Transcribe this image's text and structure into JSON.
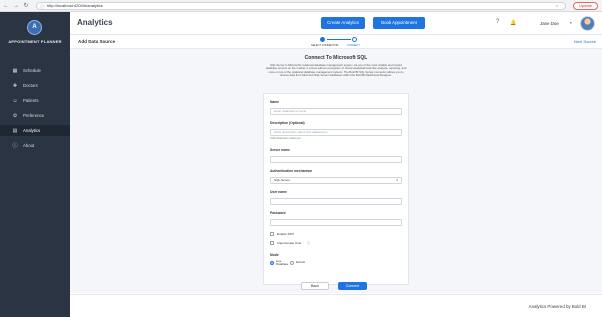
{
  "browser": {
    "back": "←",
    "forward": "→",
    "reload": "↻",
    "url": "http://localhost:4200/#/analytics",
    "update_label": "Update"
  },
  "sidebar": {
    "logo_glyph": "A",
    "brand": "APPOINTMENT PLANNER",
    "items": [
      {
        "label": "Schedule",
        "icon": "calendar-icon",
        "glyph": "▦"
      },
      {
        "label": "Doctors",
        "icon": "doctor-icon",
        "glyph": "✚"
      },
      {
        "label": "Patients",
        "icon": "patients-icon",
        "glyph": "☺"
      },
      {
        "label": "Preference",
        "icon": "gear-icon",
        "glyph": "⚙"
      },
      {
        "label": "Analytics",
        "icon": "analytics-icon",
        "glyph": "▤"
      },
      {
        "label": "About",
        "icon": "info-icon",
        "glyph": "ⓘ"
      }
    ],
    "active_index": 4
  },
  "header": {
    "title": "Analytics",
    "create_label": "Create Analytics",
    "book_label": "Book Appointment",
    "user_name": "Jane Doe",
    "caret": "▾",
    "help_glyph": "?",
    "bell_glyph": "🔔"
  },
  "subheader": {
    "title": "Add Data Source",
    "next_label": "Next Source",
    "steps": [
      "SELECT CONNECTOR",
      "CONNECT"
    ]
  },
  "form": {
    "title": "Connect To Microsoft SQL",
    "description": "SQL Server is Microsoft's relational database management system. As one of the most reliable and trusted database servers on the market, it comes with an ecosystem of robust analytical tools like analysis, reporting, and more on top of the relational database management system. The Bold BI SQL Server connector allows you to access data from Microsoft SQL Server databases within the Bold BI Dashboard Designer.",
    "name_label": "Name",
    "name_placeholder": "Enter datasource name",
    "desc_label": "Description (Optional)",
    "desc_placeholder": "Write description about this datasource",
    "desc_hint": "1024 characters maximum",
    "server_label": "Server name",
    "auth_label": "Authentication mechanism",
    "auth_value": "SQL Server",
    "user_label": "User name",
    "password_label": "Password",
    "ssh_label": "Enable SSH",
    "impersonate_label": "Impersonate User",
    "mode_label": "Mode",
    "mode_live": "Live Database",
    "mode_extract": "Extract",
    "back_label": "Back",
    "connect_label": "Connect"
  },
  "footer": {
    "powered_by": "Analytics Powered by Bold BI"
  },
  "colors": {
    "sidebar_bg": "#2b3442",
    "accent": "#1f74e0",
    "content_bg": "#f4f6f9"
  }
}
